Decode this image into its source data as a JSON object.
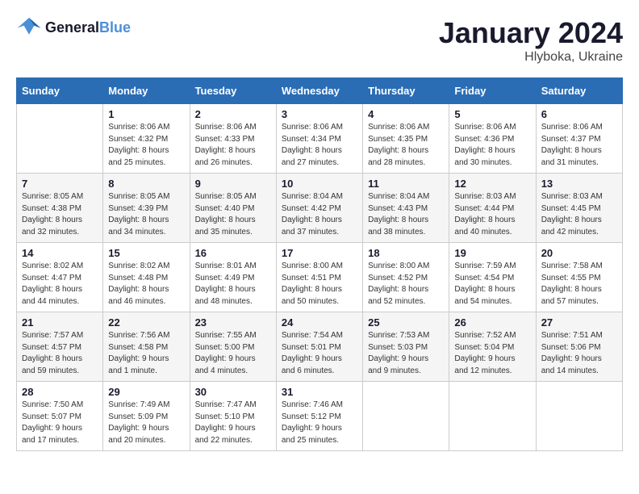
{
  "header": {
    "logo_text_general": "General",
    "logo_text_blue": "Blue",
    "month": "January 2024",
    "location": "Hlyboka, Ukraine"
  },
  "weekdays": [
    "Sunday",
    "Monday",
    "Tuesday",
    "Wednesday",
    "Thursday",
    "Friday",
    "Saturday"
  ],
  "weeks": [
    [
      {
        "day": "",
        "info": ""
      },
      {
        "day": "1",
        "info": "Sunrise: 8:06 AM\nSunset: 4:32 PM\nDaylight: 8 hours\nand 25 minutes."
      },
      {
        "day": "2",
        "info": "Sunrise: 8:06 AM\nSunset: 4:33 PM\nDaylight: 8 hours\nand 26 minutes."
      },
      {
        "day": "3",
        "info": "Sunrise: 8:06 AM\nSunset: 4:34 PM\nDaylight: 8 hours\nand 27 minutes."
      },
      {
        "day": "4",
        "info": "Sunrise: 8:06 AM\nSunset: 4:35 PM\nDaylight: 8 hours\nand 28 minutes."
      },
      {
        "day": "5",
        "info": "Sunrise: 8:06 AM\nSunset: 4:36 PM\nDaylight: 8 hours\nand 30 minutes."
      },
      {
        "day": "6",
        "info": "Sunrise: 8:06 AM\nSunset: 4:37 PM\nDaylight: 8 hours\nand 31 minutes."
      }
    ],
    [
      {
        "day": "7",
        "info": "Sunrise: 8:05 AM\nSunset: 4:38 PM\nDaylight: 8 hours\nand 32 minutes."
      },
      {
        "day": "8",
        "info": "Sunrise: 8:05 AM\nSunset: 4:39 PM\nDaylight: 8 hours\nand 34 minutes."
      },
      {
        "day": "9",
        "info": "Sunrise: 8:05 AM\nSunset: 4:40 PM\nDaylight: 8 hours\nand 35 minutes."
      },
      {
        "day": "10",
        "info": "Sunrise: 8:04 AM\nSunset: 4:42 PM\nDaylight: 8 hours\nand 37 minutes."
      },
      {
        "day": "11",
        "info": "Sunrise: 8:04 AM\nSunset: 4:43 PM\nDaylight: 8 hours\nand 38 minutes."
      },
      {
        "day": "12",
        "info": "Sunrise: 8:03 AM\nSunset: 4:44 PM\nDaylight: 8 hours\nand 40 minutes."
      },
      {
        "day": "13",
        "info": "Sunrise: 8:03 AM\nSunset: 4:45 PM\nDaylight: 8 hours\nand 42 minutes."
      }
    ],
    [
      {
        "day": "14",
        "info": "Sunrise: 8:02 AM\nSunset: 4:47 PM\nDaylight: 8 hours\nand 44 minutes."
      },
      {
        "day": "15",
        "info": "Sunrise: 8:02 AM\nSunset: 4:48 PM\nDaylight: 8 hours\nand 46 minutes."
      },
      {
        "day": "16",
        "info": "Sunrise: 8:01 AM\nSunset: 4:49 PM\nDaylight: 8 hours\nand 48 minutes."
      },
      {
        "day": "17",
        "info": "Sunrise: 8:00 AM\nSunset: 4:51 PM\nDaylight: 8 hours\nand 50 minutes."
      },
      {
        "day": "18",
        "info": "Sunrise: 8:00 AM\nSunset: 4:52 PM\nDaylight: 8 hours\nand 52 minutes."
      },
      {
        "day": "19",
        "info": "Sunrise: 7:59 AM\nSunset: 4:54 PM\nDaylight: 8 hours\nand 54 minutes."
      },
      {
        "day": "20",
        "info": "Sunrise: 7:58 AM\nSunset: 4:55 PM\nDaylight: 8 hours\nand 57 minutes."
      }
    ],
    [
      {
        "day": "21",
        "info": "Sunrise: 7:57 AM\nSunset: 4:57 PM\nDaylight: 8 hours\nand 59 minutes."
      },
      {
        "day": "22",
        "info": "Sunrise: 7:56 AM\nSunset: 4:58 PM\nDaylight: 9 hours\nand 1 minute."
      },
      {
        "day": "23",
        "info": "Sunrise: 7:55 AM\nSunset: 5:00 PM\nDaylight: 9 hours\nand 4 minutes."
      },
      {
        "day": "24",
        "info": "Sunrise: 7:54 AM\nSunset: 5:01 PM\nDaylight: 9 hours\nand 6 minutes."
      },
      {
        "day": "25",
        "info": "Sunrise: 7:53 AM\nSunset: 5:03 PM\nDaylight: 9 hours\nand 9 minutes."
      },
      {
        "day": "26",
        "info": "Sunrise: 7:52 AM\nSunset: 5:04 PM\nDaylight: 9 hours\nand 12 minutes."
      },
      {
        "day": "27",
        "info": "Sunrise: 7:51 AM\nSunset: 5:06 PM\nDaylight: 9 hours\nand 14 minutes."
      }
    ],
    [
      {
        "day": "28",
        "info": "Sunrise: 7:50 AM\nSunset: 5:07 PM\nDaylight: 9 hours\nand 17 minutes."
      },
      {
        "day": "29",
        "info": "Sunrise: 7:49 AM\nSunset: 5:09 PM\nDaylight: 9 hours\nand 20 minutes."
      },
      {
        "day": "30",
        "info": "Sunrise: 7:47 AM\nSunset: 5:10 PM\nDaylight: 9 hours\nand 22 minutes."
      },
      {
        "day": "31",
        "info": "Sunrise: 7:46 AM\nSunset: 5:12 PM\nDaylight: 9 hours\nand 25 minutes."
      },
      {
        "day": "",
        "info": ""
      },
      {
        "day": "",
        "info": ""
      },
      {
        "day": "",
        "info": ""
      }
    ]
  ]
}
